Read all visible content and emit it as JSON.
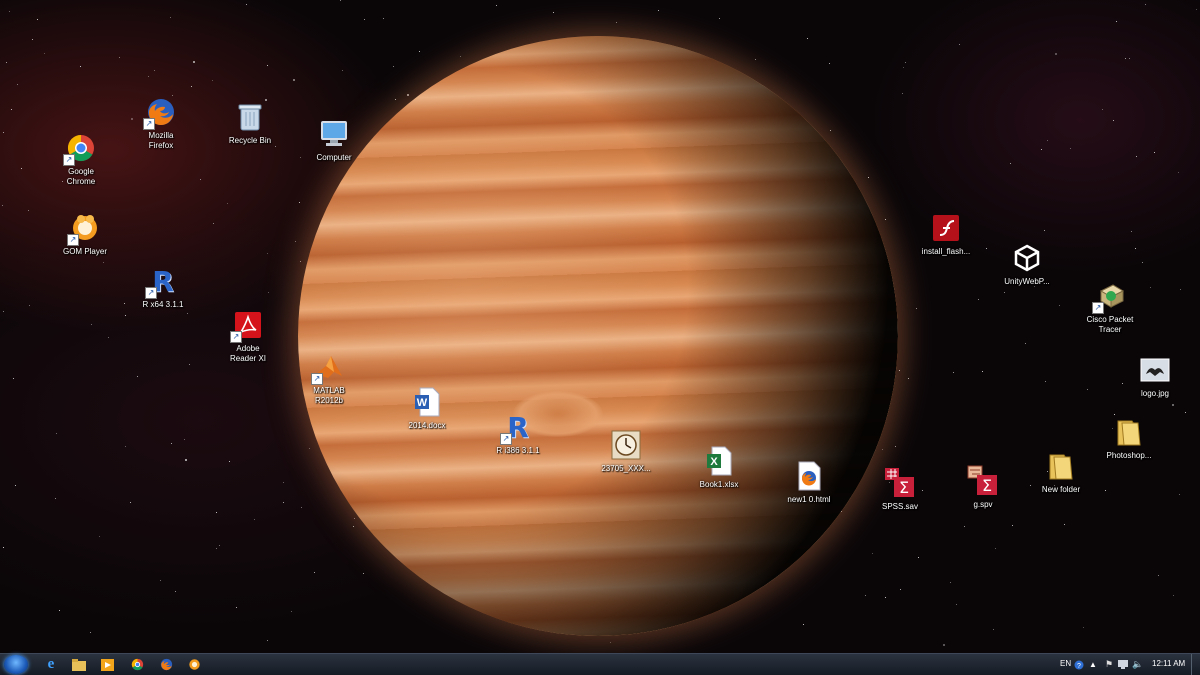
{
  "desktop": {
    "icons": [
      {
        "label": "Mozilla\nFirefox",
        "icon": "firefox-icon",
        "shortcut": true
      },
      {
        "label": "Recycle Bin",
        "icon": "recycle-bin-icon",
        "shortcut": false
      },
      {
        "label": "Computer",
        "icon": "computer-icon",
        "shortcut": false
      },
      {
        "label": "Google\nChrome",
        "icon": "chrome-icon",
        "shortcut": true
      },
      {
        "label": "GOM Player",
        "icon": "gom-player-icon",
        "shortcut": true
      },
      {
        "label": "R x64 3.1.1",
        "icon": "r-icon",
        "shortcut": true
      },
      {
        "label": "Adobe\nReader XI",
        "icon": "adobe-reader-icon",
        "shortcut": true
      },
      {
        "label": "MATLAB\nR2012b",
        "icon": "matlab-icon",
        "shortcut": true
      },
      {
        "label": "2014.docx",
        "icon": "word-doc-icon",
        "shortcut": false
      },
      {
        "label": "R i386 3.1.1",
        "icon": "r-icon",
        "shortcut": true
      },
      {
        "label": "23705_XXX...",
        "icon": "clock-file-icon",
        "shortcut": false
      },
      {
        "label": "Book1.xlsx",
        "icon": "excel-file-icon",
        "shortcut": false
      },
      {
        "label": "new1  0.html",
        "icon": "firefox-html-icon",
        "shortcut": false
      },
      {
        "label": "SPSS.sav",
        "icon": "spss-icon",
        "shortcut": false
      },
      {
        "label": "g.spv",
        "icon": "spss-output-icon",
        "shortcut": false
      },
      {
        "label": "install_flash...",
        "icon": "flash-installer-icon",
        "shortcut": false
      },
      {
        "label": "UnityWebP...",
        "icon": "unity-icon",
        "shortcut": false
      },
      {
        "label": "Cisco Packet\nTracer",
        "icon": "cisco-packet-tracer-icon",
        "shortcut": true
      },
      {
        "label": "logo.jpg",
        "icon": "image-file-icon",
        "shortcut": false
      },
      {
        "label": "Photoshop...",
        "icon": "folder-icon",
        "shortcut": false
      },
      {
        "label": "New folder",
        "icon": "folder-icon",
        "shortcut": false
      }
    ]
  },
  "taskbar": {
    "pinned": [
      "internet-explorer-icon",
      "windows-explorer-icon",
      "media-player-icon",
      "chrome-icon",
      "firefox-icon",
      "gom-player-icon"
    ],
    "tray": {
      "language": "EN",
      "clock": "12:11 AM"
    }
  },
  "colors": {
    "taskbar": "#1d232e",
    "planet": "#d88a52",
    "background": "#0a0608"
  }
}
